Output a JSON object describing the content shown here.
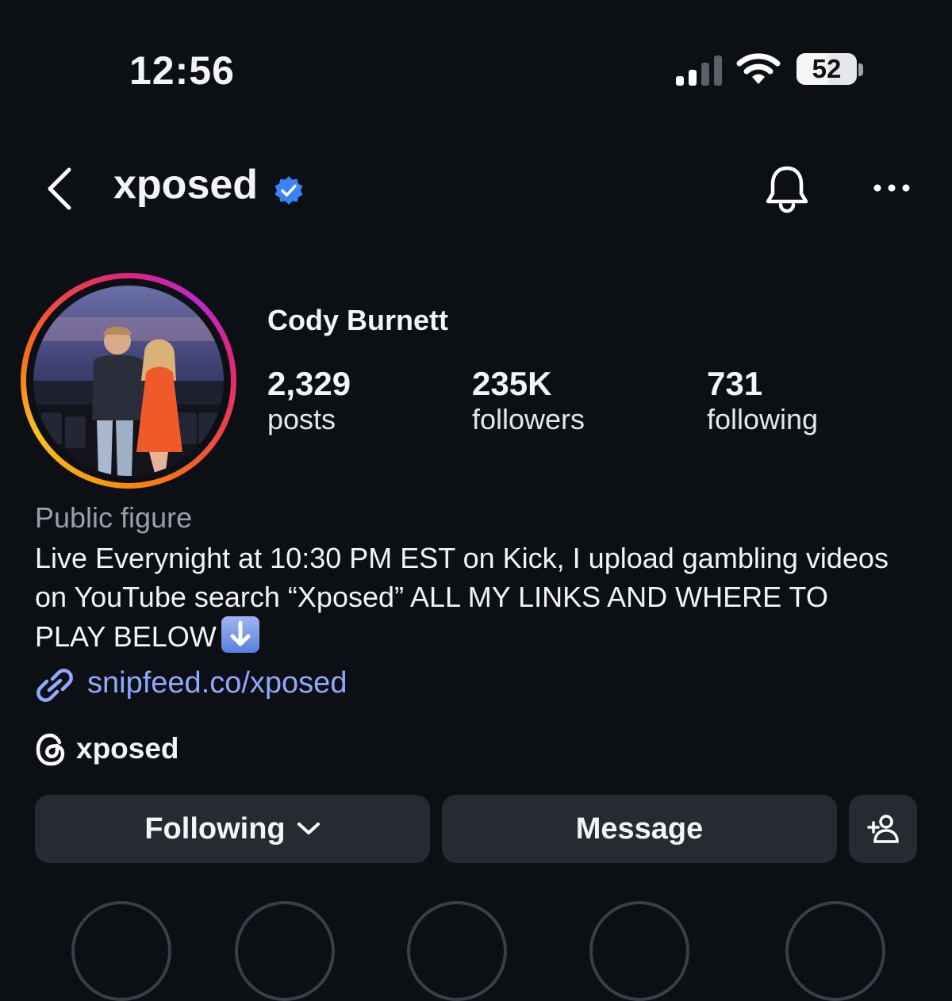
{
  "status_bar": {
    "time": "12:56",
    "battery": "52",
    "battery_fraction": 0.52
  },
  "nav": {
    "username": "xposed",
    "verified": true
  },
  "profile": {
    "display_name": "Cody Burnett",
    "stats": [
      {
        "number": "2,329",
        "label": "posts"
      },
      {
        "number": "235K",
        "label": "followers"
      },
      {
        "number": "731",
        "label": "following"
      }
    ],
    "category": "Public figure",
    "bio": "Live Everynight at 10:30 PM EST on Kick, I upload gambling videos on YouTube search “Xposed” ALL MY LINKS AND WHERE TO PLAY BELOW",
    "link": "snipfeed.co/xposed",
    "threads_handle": "xposed"
  },
  "actions": {
    "following_label": "Following",
    "message_label": "Message"
  },
  "icons": [
    "back-icon",
    "verified-badge-icon",
    "bell-icon",
    "more-icon",
    "link-icon",
    "threads-icon",
    "chevron-down-icon",
    "add-user-icon",
    "down-arrow-emoji"
  ],
  "colors": {
    "background": "#0c0f14",
    "verified": "#3b82f6",
    "link": "#8fa9ff",
    "button": "#262a31"
  }
}
